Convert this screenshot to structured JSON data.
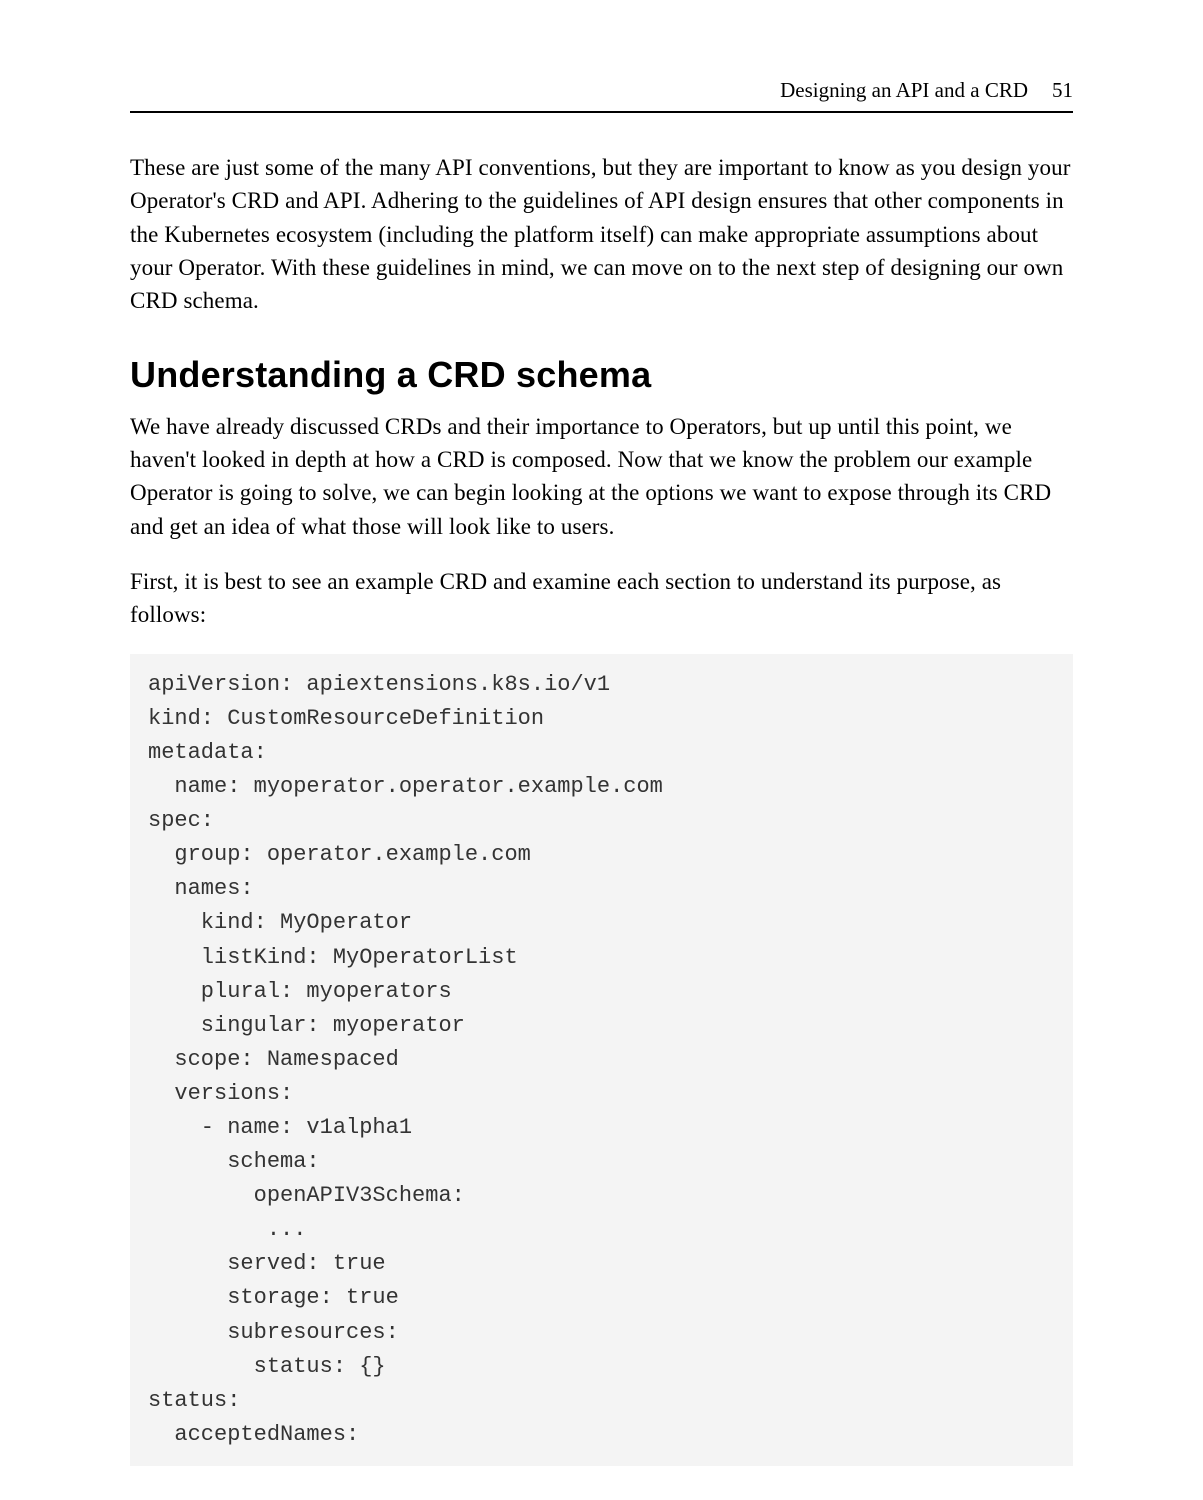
{
  "header": {
    "running_title": "Designing an API and a CRD",
    "page_number": "51"
  },
  "paragraphs": {
    "intro": "These are just some of the many API conventions, but they are important to know as you design your Operator's CRD and API. Adhering to the guidelines of API design ensures that other components in the Kubernetes ecosystem (including the platform itself) can make appropriate assumptions about your Operator. With these guidelines in mind, we can move on to the next step of designing our own CRD schema.",
    "section_heading": "Understanding a CRD schema",
    "p1": "We have already discussed CRDs and their importance to Operators, but up until this point, we haven't looked in depth at how a CRD is composed. Now that we know the problem our example Operator is going to solve, we can begin looking at the options we want to expose through its CRD and get an idea of what those will look like to users.",
    "p2": "First, it is best to see an example CRD and examine each section to understand its purpose, as follows:"
  },
  "code": "apiVersion: apiextensions.k8s.io/v1\nkind: CustomResourceDefinition\nmetadata:\n  name: myoperator.operator.example.com\nspec:\n  group: operator.example.com\n  names:\n    kind: MyOperator\n    listKind: MyOperatorList\n    plural: myoperators\n    singular: myoperator\n  scope: Namespaced\n  versions:\n    - name: v1alpha1\n      schema:\n        openAPIV3Schema:\n         ...\n      served: true\n      storage: true\n      subresources:\n        status: {}\nstatus:\n  acceptedNames:"
}
